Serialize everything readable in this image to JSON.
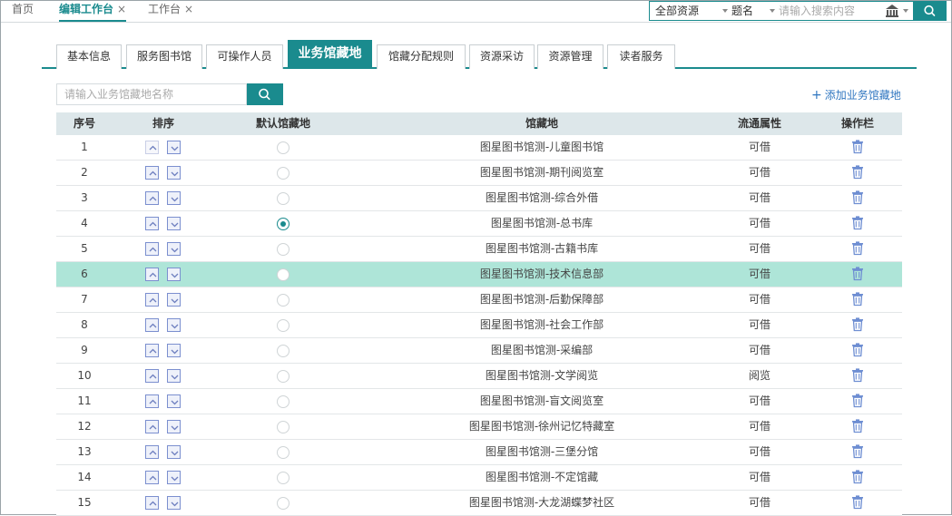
{
  "top_tabs": [
    {
      "label": "首页",
      "closable": false,
      "active": false
    },
    {
      "label": "编辑工作台",
      "closable": true,
      "active": true
    },
    {
      "label": "工作台",
      "closable": true,
      "active": false
    }
  ],
  "close_glyph": "×",
  "search": {
    "resource_select": "全部资源",
    "field_select": "题名",
    "placeholder": "请输入搜索内容",
    "library_icon": "library-icon",
    "button_icon": "search-icon"
  },
  "section_tabs": [
    {
      "label": "基本信息",
      "active": false
    },
    {
      "label": "服务图书馆",
      "active": false
    },
    {
      "label": "可操作人员",
      "active": false
    },
    {
      "label": "业务馆藏地",
      "active": true
    },
    {
      "label": "馆藏分配规则",
      "active": false
    },
    {
      "label": "资源采访",
      "active": false
    },
    {
      "label": "资源管理",
      "active": false
    },
    {
      "label": "读者服务",
      "active": false
    }
  ],
  "list_search": {
    "placeholder": "请输入业务馆藏地名称",
    "button_icon": "search-icon"
  },
  "add_link": {
    "plus": "+",
    "label": "添加业务馆藏地"
  },
  "table": {
    "headers": {
      "no": "序号",
      "sort": "排序",
      "default": "默认馆藏地",
      "location": "馆藏地",
      "circulation": "流通属性",
      "actions": "操作栏"
    },
    "rows": [
      {
        "no": "1",
        "location": "图星图书馆测-儿童图书馆",
        "circulation": "可借",
        "default": false,
        "highlight": false
      },
      {
        "no": "2",
        "location": "图星图书馆测-期刊阅览室",
        "circulation": "可借",
        "default": false,
        "highlight": false
      },
      {
        "no": "3",
        "location": "图星图书馆测-综合外借",
        "circulation": "可借",
        "default": false,
        "highlight": false
      },
      {
        "no": "4",
        "location": "图星图书馆测-总书库",
        "circulation": "可借",
        "default": true,
        "highlight": false
      },
      {
        "no": "5",
        "location": "图星图书馆测-古籍书库",
        "circulation": "可借",
        "default": false,
        "highlight": false
      },
      {
        "no": "6",
        "location": "图星图书馆测-技术信息部",
        "circulation": "可借",
        "default": false,
        "highlight": true
      },
      {
        "no": "7",
        "location": "图星图书馆测-后勤保障部",
        "circulation": "可借",
        "default": false,
        "highlight": false
      },
      {
        "no": "8",
        "location": "图星图书馆测-社会工作部",
        "circulation": "可借",
        "default": false,
        "highlight": false
      },
      {
        "no": "9",
        "location": "图星图书馆测-采编部",
        "circulation": "可借",
        "default": false,
        "highlight": false
      },
      {
        "no": "10",
        "location": "图星图书馆测-文学阅览",
        "circulation": "阅览",
        "default": false,
        "highlight": false
      },
      {
        "no": "11",
        "location": "图星图书馆测-盲文阅览室",
        "circulation": "可借",
        "default": false,
        "highlight": false
      },
      {
        "no": "12",
        "location": "图星图书馆测-徐州记忆特藏室",
        "circulation": "可借",
        "default": false,
        "highlight": false
      },
      {
        "no": "13",
        "location": "图星图书馆测-三堡分馆",
        "circulation": "可借",
        "default": false,
        "highlight": false
      },
      {
        "no": "14",
        "location": "图星图书馆测-不定馆藏",
        "circulation": "可借",
        "default": false,
        "highlight": false
      },
      {
        "no": "15",
        "location": "图星图书馆测-大龙湖蝶梦社区",
        "circulation": "可借",
        "default": false,
        "highlight": false
      }
    ]
  },
  "colors": {
    "accent": "#1a8b8e",
    "highlight_row": "#aee5d8",
    "link": "#2f76c0",
    "header_bg": "#dde7ea"
  }
}
